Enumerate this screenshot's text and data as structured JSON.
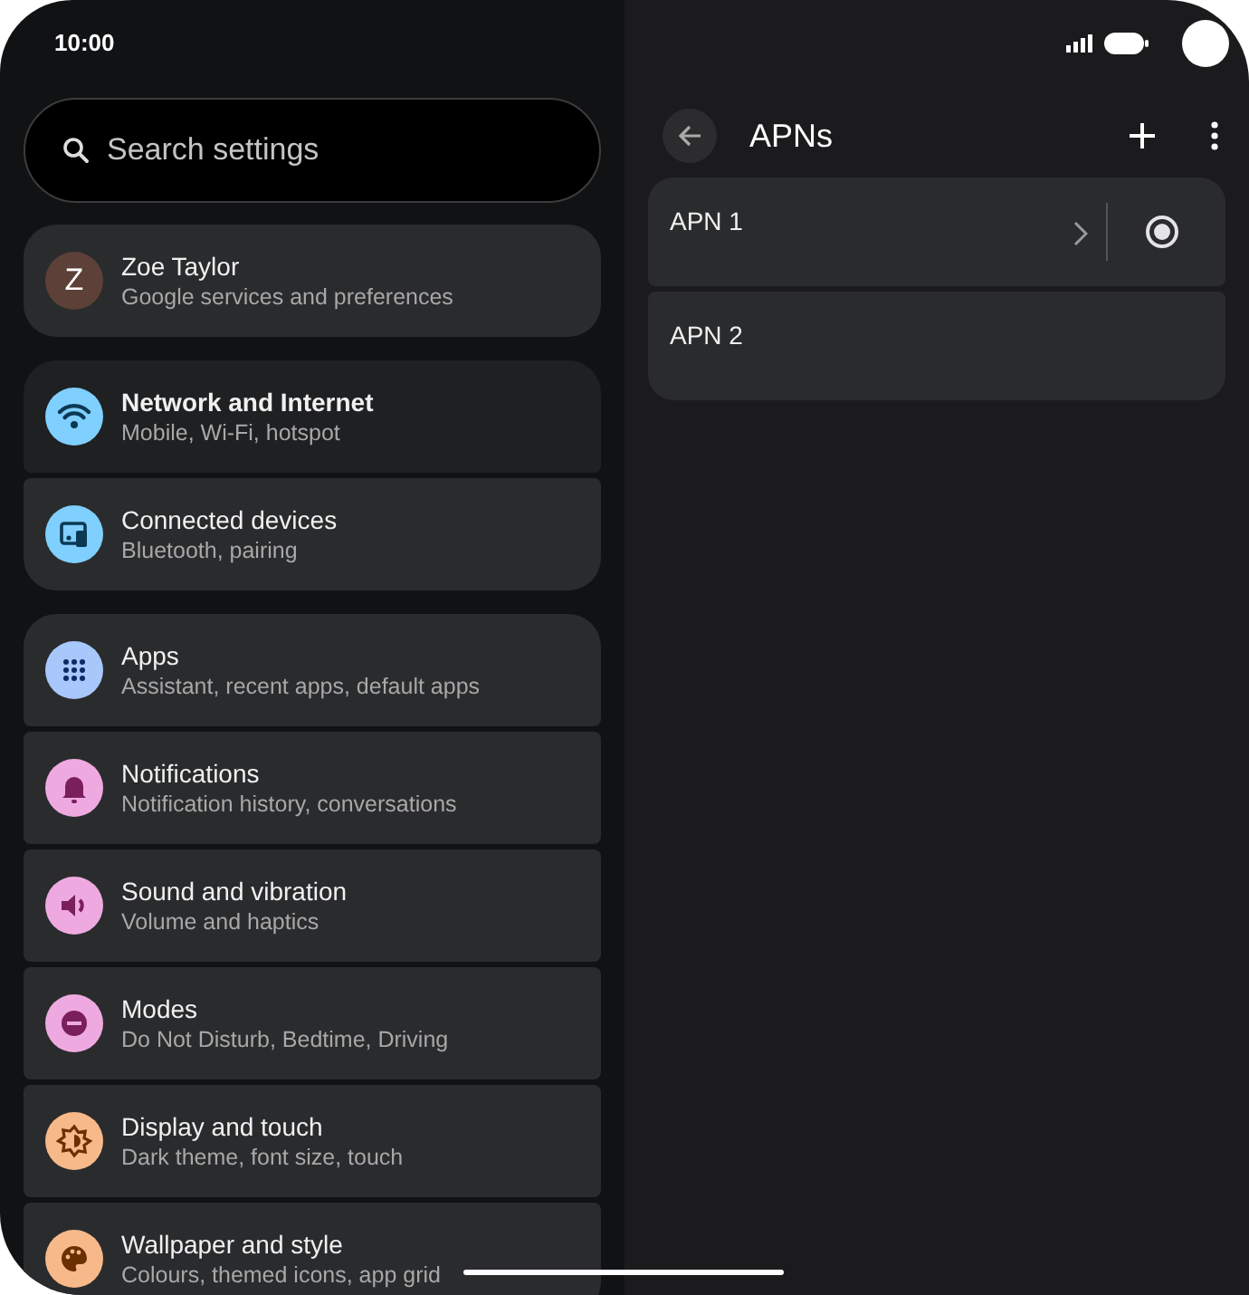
{
  "status_bar": {
    "time": "10:00"
  },
  "search": {
    "placeholder": "Search settings"
  },
  "groups": [
    {
      "items": [
        {
          "kind": "avatar",
          "letter": "Z",
          "title": "Zoe Taylor",
          "subtitle": "Google services and preferences",
          "color": "#5d4037",
          "selected": false
        }
      ]
    },
    {
      "items": [
        {
          "kind": "wifi",
          "title": "Network and Internet",
          "subtitle": "Mobile, Wi-Fi, hotspot",
          "color": "#7fcfff",
          "selected": true
        },
        {
          "kind": "devices",
          "title": "Connected devices",
          "subtitle": "Bluetooth, pairing",
          "color": "#7fcfff",
          "selected": false
        }
      ]
    },
    {
      "items": [
        {
          "kind": "apps",
          "title": "Apps",
          "subtitle": "Assistant, recent apps, default apps",
          "color": "#a8c7fa",
          "selected": false
        },
        {
          "kind": "bell",
          "title": "Notifications",
          "subtitle": "Notification history, conversations",
          "color": "#eeaae0",
          "selected": false
        },
        {
          "kind": "sound",
          "title": "Sound and vibration",
          "subtitle": "Volume and haptics",
          "color": "#eeaae0",
          "selected": false
        },
        {
          "kind": "modes",
          "title": "Modes",
          "subtitle": "Do Not Disturb, Bedtime, Driving",
          "color": "#eeaae0",
          "selected": false
        },
        {
          "kind": "display",
          "title": "Display and touch",
          "subtitle": "Dark theme, font size, touch",
          "color": "#f8b98a",
          "selected": false
        },
        {
          "kind": "palette",
          "title": "Wallpaper and style",
          "subtitle": "Colours, themed icons, app grid",
          "color": "#f8b98a",
          "selected": false
        }
      ]
    }
  ],
  "detail": {
    "title": "APNs",
    "apns": [
      {
        "name": "APN 1",
        "selected": true
      },
      {
        "name": "APN 2",
        "selected": false
      }
    ]
  }
}
